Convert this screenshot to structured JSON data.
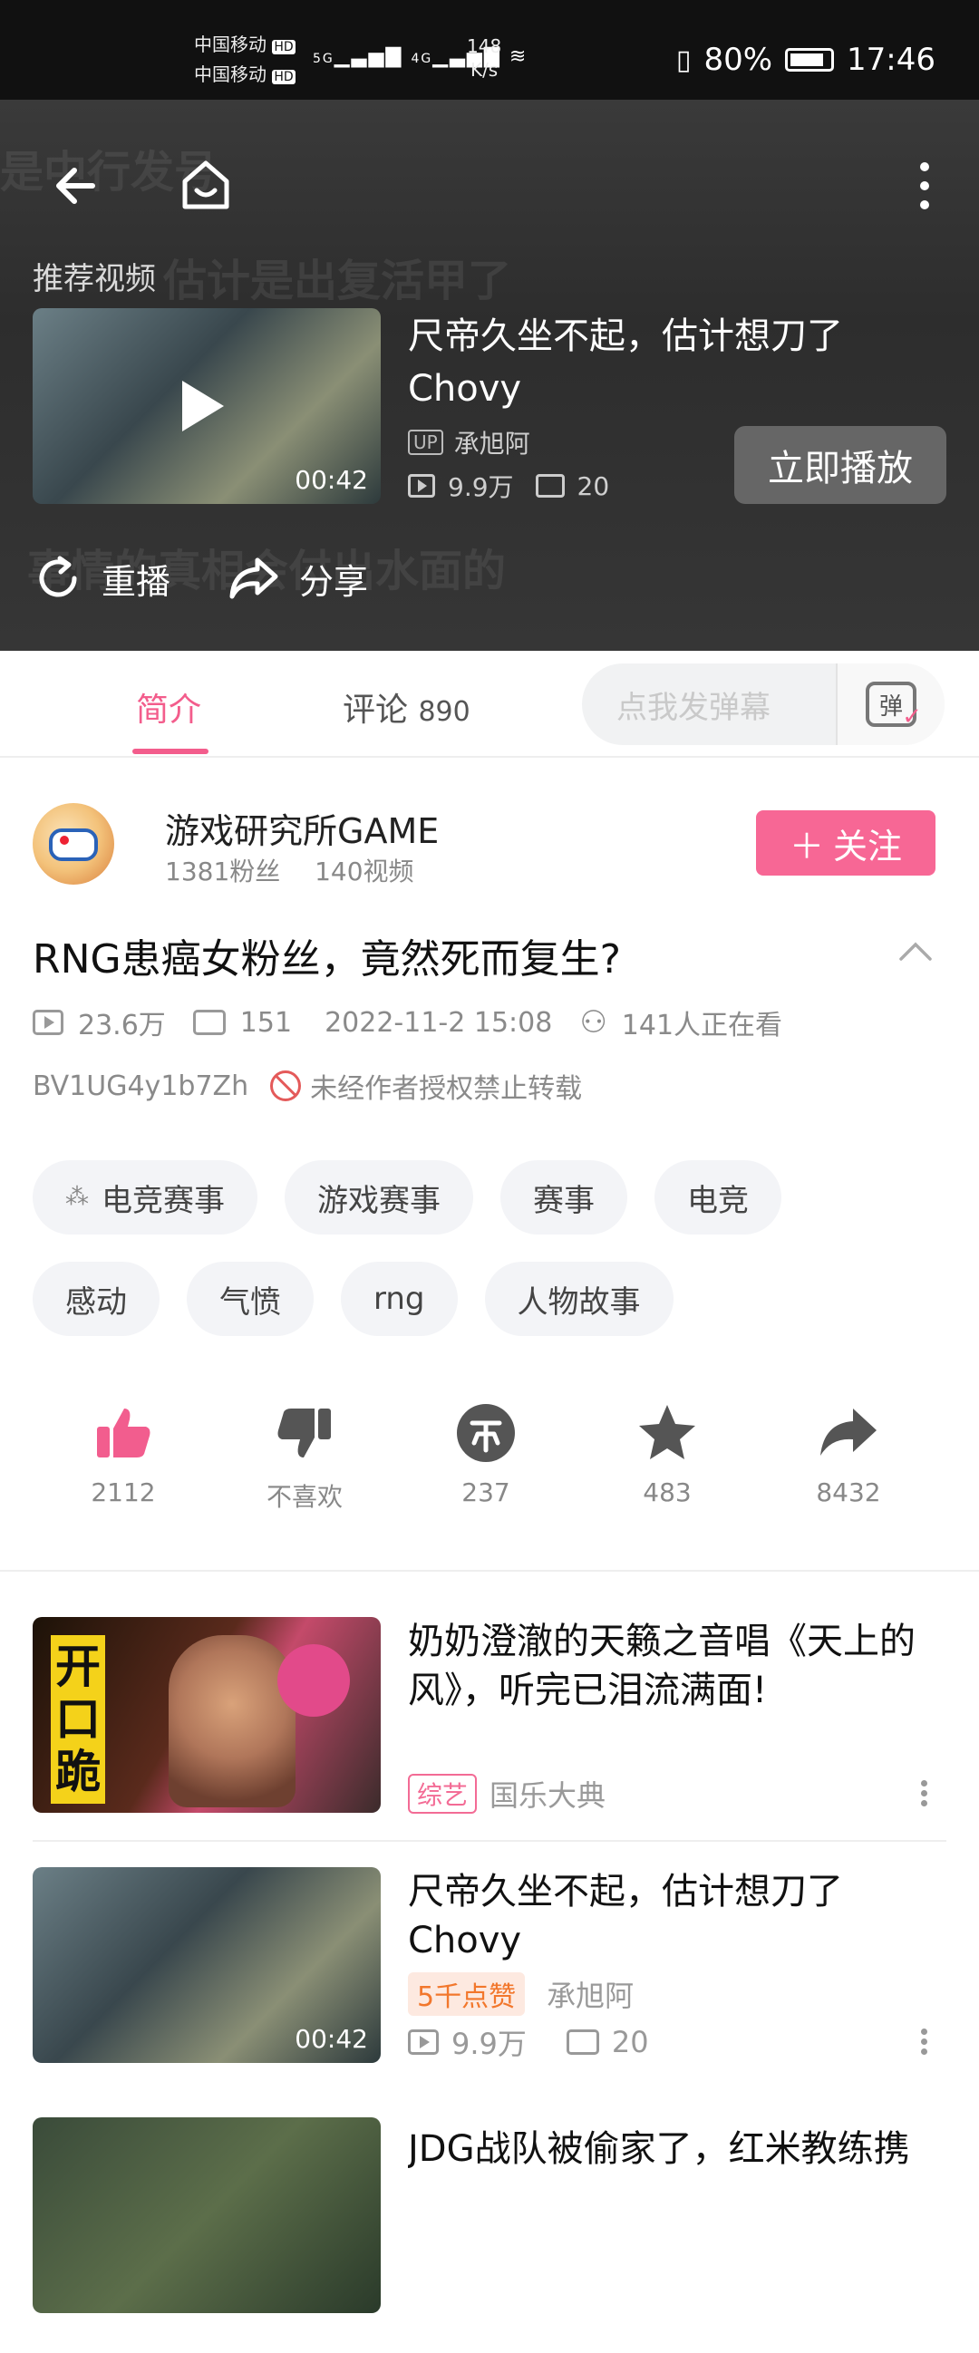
{
  "status_bar": {
    "carrier1": "中国移动",
    "carrier2": "中国移动",
    "hd1": "HD",
    "hd2": "HD",
    "net1": "5G",
    "net2": "4G",
    "speed_value": "148",
    "speed_unit": "K/s",
    "battery": "80%",
    "time": "17:46"
  },
  "player": {
    "recommend_label": "推荐视频",
    "rec_title": "尺帝久坐不起，估计想刀了Chovy",
    "rec_duration": "00:42",
    "rec_up_badge": "UP",
    "rec_uploader": "承旭阿",
    "rec_views": "9.9万",
    "rec_danmaku": "20",
    "play_now": "立即播放",
    "replay": "重播",
    "share": "分享"
  },
  "tabs": {
    "intro": "简介",
    "comments": "评论",
    "comments_count": "890",
    "danmu_placeholder": "点我发弹幕",
    "danmu_icon_char": "弹"
  },
  "uploader": {
    "name": "游戏研究所GAME",
    "fans": "1381粉丝",
    "videos": "140视频",
    "follow": "关注",
    "follow_plus": "＋"
  },
  "video": {
    "title": "RNG患癌女粉丝，竟然死而复生?",
    "views": "23.6万",
    "danmaku": "151",
    "date": "2022-11-2 15:08",
    "watching": "141人正在看",
    "bvid": "BV1UG4y1b7Zh",
    "copyright": "未经作者授权禁止转载"
  },
  "tags_row1": [
    "电竞赛事",
    "游戏赛事",
    "赛事",
    "电竞"
  ],
  "tags_row2": [
    "感动",
    "气愤",
    "rng",
    "人物故事"
  ],
  "actions": {
    "like": "2112",
    "dislike": "不喜欢",
    "coin": "237",
    "fav": "483",
    "share": "8432"
  },
  "related": [
    {
      "title": "奶奶澄澈的天籁之音唱《天上的风》，听完已泪流满面!",
      "badge": "综艺",
      "source": "国乐大典",
      "thumb_text": "开口跪"
    },
    {
      "title": "尺帝久坐不起，估计想刀了Chovy",
      "hot": "5千点赞",
      "uploader": "承旭阿",
      "views": "9.9万",
      "danmaku": "20",
      "duration": "00:42"
    },
    {
      "title": "JDG战队被偷家了，红米教练携"
    }
  ],
  "colors": {
    "accent": "#f35d8c",
    "follow_bg": "#f76795"
  }
}
